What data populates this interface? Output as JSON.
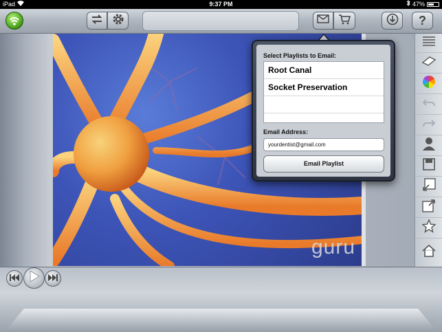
{
  "status_bar": {
    "device": "iPad",
    "time": "9:37 PM",
    "battery": "47%",
    "battery_level": 0.47
  },
  "toolbar": {
    "wifi_icon": "wifi-icon",
    "swap_icon": "swap-arrows-icon",
    "settings_icon": "gear-icon",
    "mail_icon": "mail-icon",
    "cart_icon": "cart-icon",
    "download_icon": "download-icon",
    "help_icon": "help-icon",
    "help_label": "?"
  },
  "slide": {
    "watermark": "guru"
  },
  "popover": {
    "playlists_label": "Select Playlists to Email:",
    "playlists": [
      "Root Canal",
      "Socket Preservation",
      "",
      ""
    ],
    "email_label": "Email Address:",
    "email_value": "yourdentist@gmail.com",
    "button_label": "Email Playlist"
  },
  "sidebar": {
    "items": [
      "list-icon",
      "eraser-icon",
      "color-wheel-icon",
      "undo-icon",
      "redo-icon",
      "person-icon",
      "save-icon",
      "image-import-icon",
      "image-export-icon",
      "star-icon",
      "home-icon"
    ]
  },
  "player": {
    "controls": [
      "rewind-icon",
      "play-icon",
      "fast-forward-icon"
    ]
  },
  "colors": {
    "wifi_green": "#3f9a15",
    "slide_blue": "#3d55b8",
    "nerve_orange": "#f08a3a"
  }
}
